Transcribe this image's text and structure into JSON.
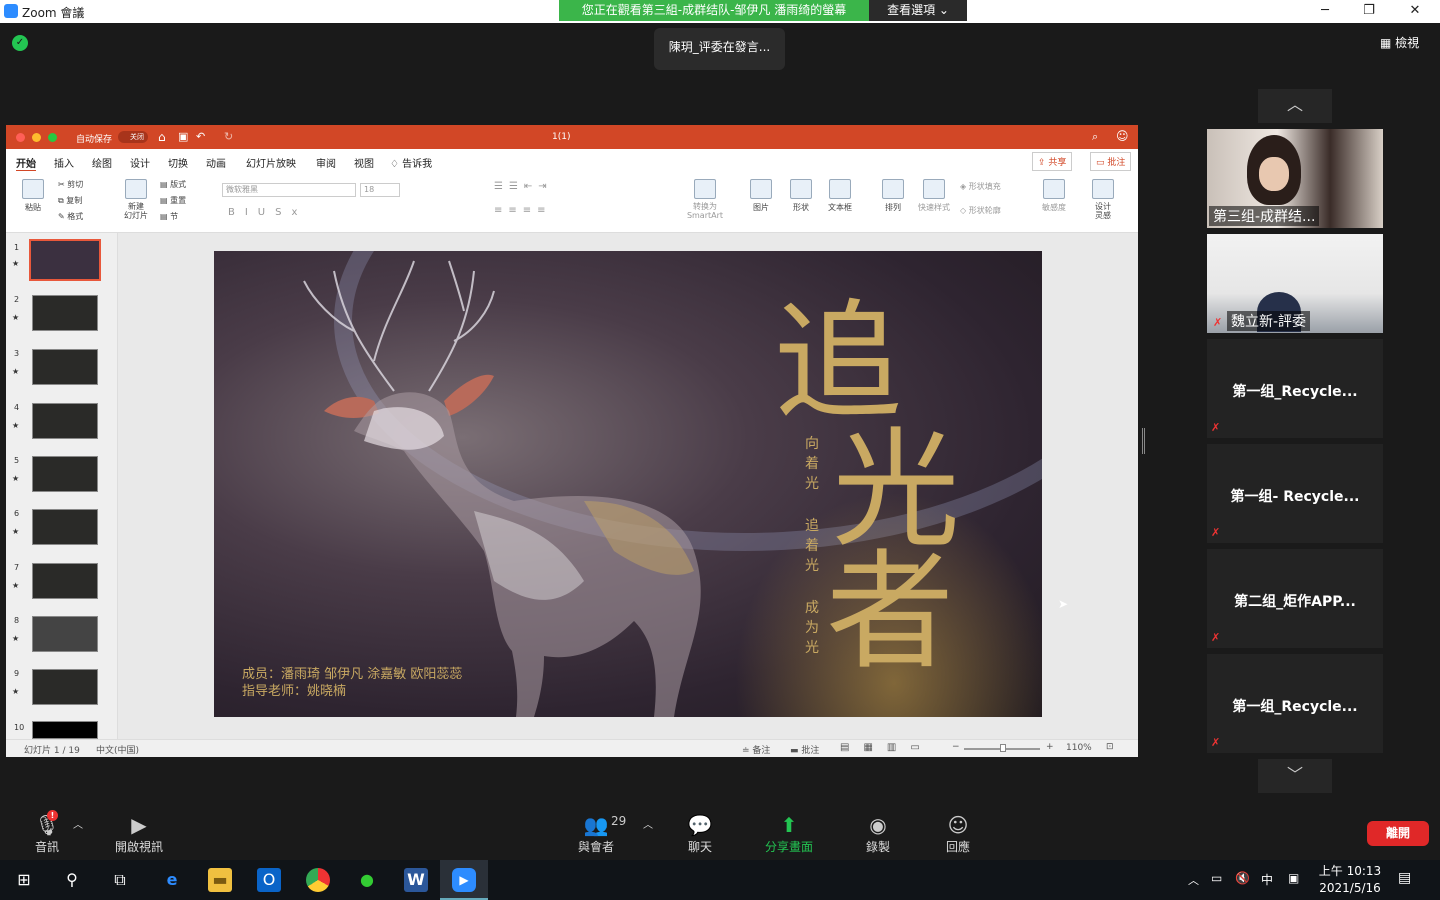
{
  "window": {
    "title": "Zoom 會議",
    "minimize": "─",
    "restore": "❐",
    "close": "✕"
  },
  "share_banner": {
    "text": "您正在觀看第三組-成群结队-邹伊凡 潘雨绮的螢幕",
    "view_options": "查看選項 ⌄"
  },
  "speaker": {
    "text": "陳玥_评委在發言..."
  },
  "gallery_view": {
    "label": "檢視"
  },
  "ppt": {
    "autosave": "自动保存",
    "autosave_state": "关闭",
    "doc_title": "1(1)",
    "tabs": [
      "开始",
      "插入",
      "绘图",
      "设计",
      "切换",
      "动画",
      "幻灯片放映",
      "审阅",
      "视图",
      "告诉我"
    ],
    "share_btn": "共享",
    "comment_btn": "批注",
    "ribbon": {
      "paste": "粘贴",
      "cut": "剪切",
      "copy": "复制",
      "format": "格式",
      "new_slide": "新建\n幻灯片",
      "layout": "版式",
      "reset": "重置",
      "section": "节",
      "font": "微软雅黑",
      "size": "18",
      "smartart": "转换为\nSmartArt",
      "picture": "图片",
      "shape": "形状",
      "textbox": "文本框",
      "arrange": "排列",
      "quick_style": "快速样式",
      "shape_fill": "形状填充",
      "shape_outline": "形状轮廓",
      "sensitivity": "敏感度",
      "designer": "设计\n灵感"
    },
    "thumbnails": [
      "1",
      "2",
      "3",
      "4",
      "5",
      "6",
      "7",
      "8",
      "9",
      "10"
    ],
    "slide": {
      "title_chars": [
        "追",
        "光",
        "者"
      ],
      "subtitle_chars": [
        "向",
        "着",
        "光",
        "追",
        "着",
        "光",
        "成",
        "为",
        "光"
      ],
      "members": "成员：潘雨琦 邹伊凡 涂嘉敏 欧阳蕊蕊",
      "advisor": "指导老师：姚晓楠"
    },
    "status": {
      "slide_count": "幻灯片 1 / 19",
      "language": "中文(中国)",
      "notes": "备注",
      "comments": "批注",
      "zoom": "110%"
    }
  },
  "participants": [
    {
      "name": "第三组-成群结...",
      "video": true
    },
    {
      "name": "魏立新-評委",
      "video": true
    },
    {
      "name": "第一组_Recycle...",
      "video": false
    },
    {
      "name": "第一组- Recycle...",
      "video": false
    },
    {
      "name": "第二组_炬作APP...",
      "video": false
    },
    {
      "name": "第一组_Recycle...",
      "video": false
    }
  ],
  "toolbar": {
    "audio": "音訊",
    "video": "開啟視訊",
    "participants": "與會者",
    "participant_count": "29",
    "chat": "聊天",
    "share": "分享畫面",
    "record": "錄製",
    "reactions": "回應",
    "leave": "離開"
  },
  "taskbar": {
    "ime": "中",
    "time": "上午 10:13",
    "date": "2021/5/16"
  },
  "colors": {
    "zoom_blue": "#2d8cff",
    "share_green": "#3bb54a",
    "ppt_red": "#d24726",
    "leave_red": "#e02828"
  }
}
